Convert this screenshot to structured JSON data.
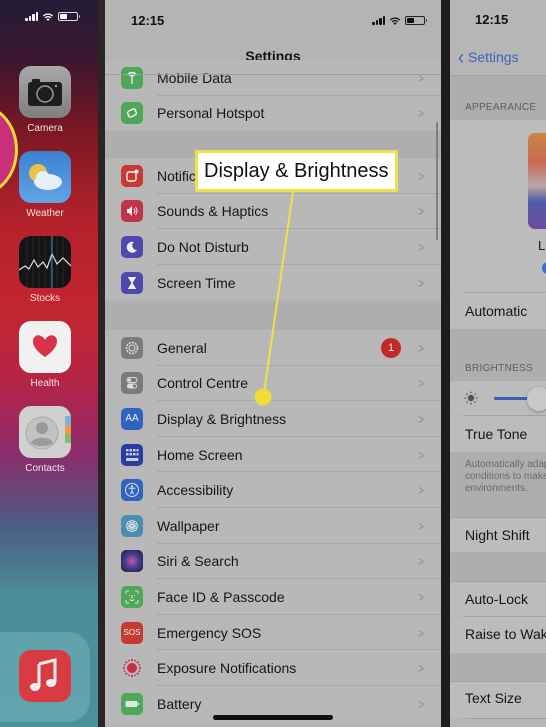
{
  "home_screen": {
    "apps": [
      {
        "name": "Camera",
        "icon": "camera-icon"
      },
      {
        "name": "Weather",
        "icon": "weather-icon"
      },
      {
        "name": "Stocks",
        "icon": "stocks-icon"
      },
      {
        "name": "Health",
        "icon": "health-icon"
      },
      {
        "name": "Contacts",
        "icon": "contacts-icon"
      }
    ],
    "dock_apps": [
      {
        "name": "Music",
        "icon": "music-icon"
      }
    ]
  },
  "settings": {
    "time": "12:15",
    "title": "Settings",
    "groups": [
      [
        {
          "label": "Mobile Data",
          "icon": "antenna-icon",
          "color": "#4fa75a"
        },
        {
          "label": "Personal Hotspot",
          "icon": "hotspot-icon",
          "color": "#4fa75a"
        }
      ],
      [
        {
          "label": "Notifications",
          "icon": "notifications-icon",
          "color": "#c33b33"
        },
        {
          "label": "Sounds & Haptics",
          "icon": "speaker-icon",
          "color": "#c0334a"
        },
        {
          "label": "Do Not Disturb",
          "icon": "moon-icon",
          "color": "#4f48ad"
        },
        {
          "label": "Screen Time",
          "icon": "hourglass-icon",
          "color": "#4f48ad"
        }
      ],
      [
        {
          "label": "General",
          "icon": "gear-icon",
          "color": "#7c7c7c",
          "badge": "1"
        },
        {
          "label": "Control Centre",
          "icon": "toggles-icon",
          "color": "#7c7c7c"
        },
        {
          "label": "Display & Brightness",
          "icon": "text-size-icon",
          "color": "#2f63c2"
        },
        {
          "label": "Home Screen",
          "icon": "grid-icon",
          "color": "#2a3d9e"
        },
        {
          "label": "Accessibility",
          "icon": "accessibility-icon",
          "color": "#2f63c2"
        },
        {
          "label": "Wallpaper",
          "icon": "flower-icon",
          "color": "#4a8fb3"
        },
        {
          "label": "Siri & Search",
          "icon": "siri-icon",
          "color": "#2a2a4a"
        },
        {
          "label": "Face ID & Passcode",
          "icon": "face-id-icon",
          "color": "#4fa75a"
        },
        {
          "label": "Emergency SOS",
          "icon": "sos-icon",
          "color": "#c33b33"
        },
        {
          "label": "Exposure Notifications",
          "icon": "exposure-icon",
          "color": "#d8d0d0"
        },
        {
          "label": "Battery",
          "icon": "battery-icon",
          "color": "#4fa75a"
        }
      ]
    ],
    "sos_text": "SOS",
    "aa_text": "AA"
  },
  "callout": {
    "text": "Display & Brightness",
    "color": "#ece24a"
  },
  "display_brightness": {
    "time": "12:15",
    "back_label": "Settings",
    "appearance_header": "APPEARANCE",
    "light_label": "Light",
    "automatic_label": "Automatic",
    "brightness_header": "BRIGHTNESS",
    "brightness_level": 0.3,
    "true_tone_label": "True Tone",
    "true_tone_footnote": [
      "Automatically adapt iPhone display based on ambient lighting",
      "conditions to make colours appear consistent in different",
      "environments."
    ],
    "night_shift_label": "Night Shift",
    "auto_lock_label": "Auto-Lock",
    "raise_to_wake_label": "Raise to Wake",
    "text_size_label": "Text Size"
  }
}
